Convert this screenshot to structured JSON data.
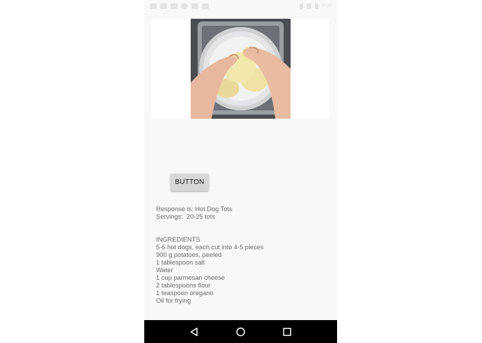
{
  "status_bar": {
    "time": "6:00"
  },
  "media": {
    "icon": "recipe-photo"
  },
  "button": {
    "label": "BUTTON"
  },
  "response": {
    "title_line": "Response is: Hot Dog Tots",
    "servings_line": "Servings:  20-25 tots"
  },
  "ingredients": {
    "heading": "INGREDIENTS",
    "items": [
      "5-6 hot dogs, each cut into 4-5 pieces",
      "900 g potatoes, peeled",
      "1 tablespoon salt",
      "Water",
      "1 cup parmesan cheese",
      "2 tablespoons flour",
      "1 teaspoon oregano",
      "Oil for frying"
    ]
  },
  "navigation": {
    "back_icon": "back-triangle-icon",
    "home_icon": "home-circle-icon",
    "recents_icon": "recents-square-icon"
  },
  "colors": {
    "app_background": "#f8f8f8",
    "nav_bar": "#000000",
    "button_bg": "#d7d7d7",
    "body_text": "#6a6a6a"
  }
}
